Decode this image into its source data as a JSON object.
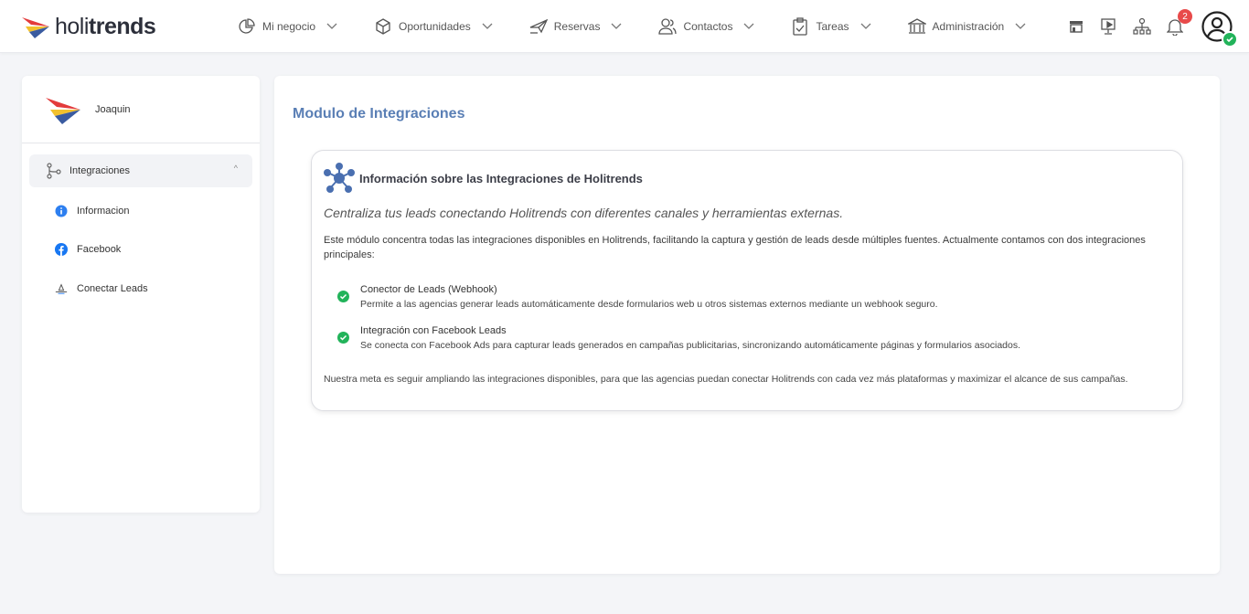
{
  "header": {
    "logo_light": "holi",
    "logo_bold": "trends",
    "nav": [
      {
        "label": "Mi negocio",
        "icon": "pie-chart-icon"
      },
      {
        "label": "Oportunidades",
        "icon": "cube-icon"
      },
      {
        "label": "Reservas",
        "icon": "plane-icon"
      },
      {
        "label": "Contactos",
        "icon": "users-icon"
      },
      {
        "label": "Tareas",
        "icon": "clipboard-check-icon"
      },
      {
        "label": "Administración",
        "icon": "bank-icon"
      }
    ],
    "notifications_count": "2",
    "right_icons": [
      "store-icon",
      "presentation-icon",
      "org-chart-icon",
      "bell-icon",
      "user-avatar-icon"
    ]
  },
  "sidebar": {
    "user_name": "Joaquin",
    "group_label": "Integraciones",
    "items": [
      {
        "label": "Informacion",
        "icon": "info-icon"
      },
      {
        "label": "Facebook",
        "icon": "facebook-icon"
      },
      {
        "label": "Conectar Leads",
        "icon": "leads-icon"
      }
    ]
  },
  "main": {
    "page_title": "Modulo de Integraciones",
    "card": {
      "title": "Información sobre las Integraciones de Holitrends",
      "subtitle": "Centraliza tus leads conectando Holitrends con diferentes canales y herramientas externas.",
      "description": "Este módulo concentra todas las integraciones disponibles en Holitrends, facilitando la captura y gestión de leads desde múltiples fuentes. Actualmente contamos con dos integraciones principales:",
      "features": [
        {
          "title": "Conector de Leads (Webhook)",
          "desc": "Permite a las agencias generar leads automáticamente desde formularios web u otros sistemas externos mediante un webhook seguro."
        },
        {
          "title": "Integración con Facebook Leads",
          "desc": "Se conecta con Facebook Ads para capturar leads generados en campañas publicitarias, sincronizando automáticamente páginas y formularios asociados."
        }
      ],
      "footer": "Nuestra meta es seguir ampliando las integraciones disponibles, para que las agencias puedan conectar Holitrends con cada vez más plataformas y maximizar el alcance de sus campañas."
    }
  },
  "colors": {
    "accent": "#5a7fb5",
    "check": "#22b35a",
    "badge": "#e84a4a",
    "facebook": "#1877f2",
    "info": "#2d7ff0"
  }
}
